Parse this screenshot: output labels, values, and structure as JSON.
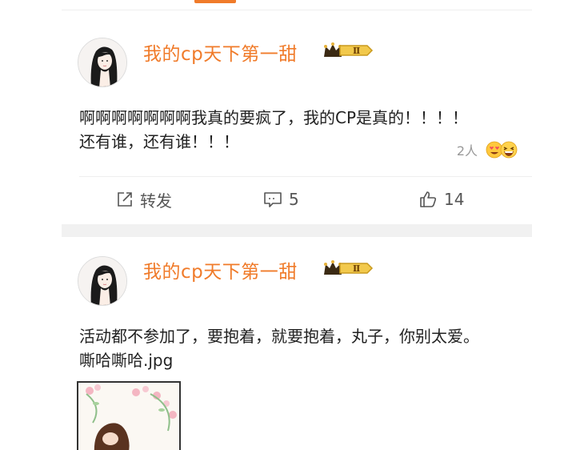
{
  "colors": {
    "accent": "#f07b2a",
    "username": "#f07b2a",
    "text": "#222222",
    "muted": "#999999",
    "action": "#555555"
  },
  "posts": [
    {
      "username": "我的cp天下第一甜",
      "vip_level": "Ⅱ",
      "content_lines": [
        "啊啊啊啊啊啊啊我真的要疯了，我的CP是真的！！！！",
        "还有谁，还有谁！！！"
      ],
      "reaction_count": "2人",
      "reaction_icons": [
        "heart-eyes-emoji",
        "grinning-squint-emoji"
      ],
      "actions": {
        "repost": "转发",
        "comment": "5",
        "like": "14"
      }
    },
    {
      "username": "我的cp天下第一甜",
      "vip_level": "Ⅱ",
      "content_lines": [
        "活动都不参加了，要抱着，就要抱着，丸子，你别太爱。",
        "嘶哈嘶哈.jpg"
      ],
      "image": "illustration-thumbnail"
    }
  ]
}
